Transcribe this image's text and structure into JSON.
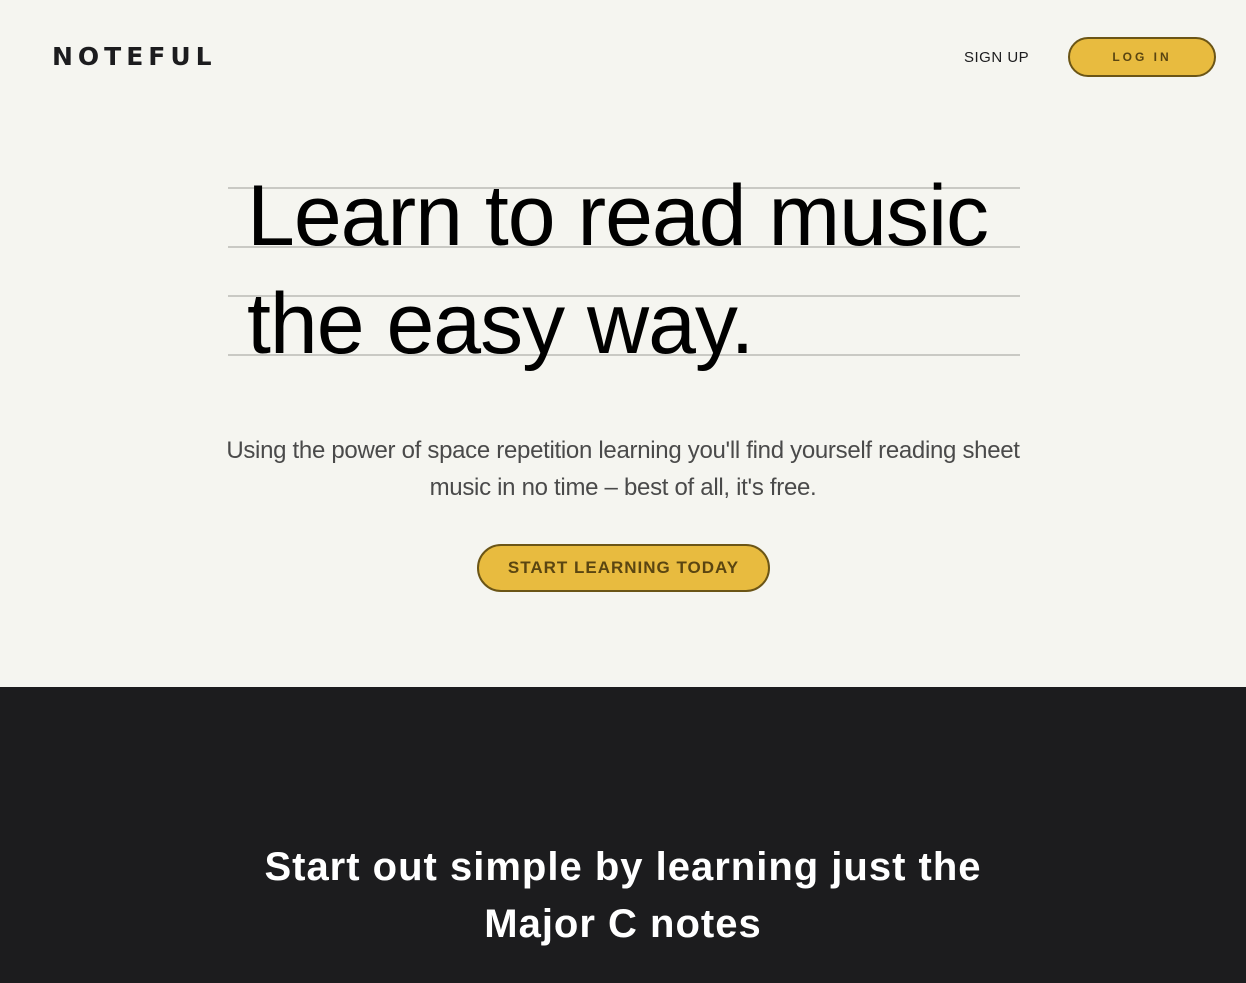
{
  "header": {
    "logo": "NOTEFUL",
    "signup_label": "SIGN UP",
    "login_label": "LOG IN"
  },
  "hero": {
    "headline_line1": "Learn to read music",
    "headline_line2": "the easy way.",
    "subtitle": "Using the power of space repetition learning you'll find yourself reading sheet music in no time – best of all, it's free.",
    "cta_label": "START LEARNING TODAY"
  },
  "section": {
    "title": "Start out simple by learning just the Major C notes"
  },
  "colors": {
    "background": "#f5f5f0",
    "accent": "#e8bb3f",
    "accent_border": "#6b5516",
    "dark": "#1c1c1e",
    "staff_line": "#c9c9c4"
  }
}
